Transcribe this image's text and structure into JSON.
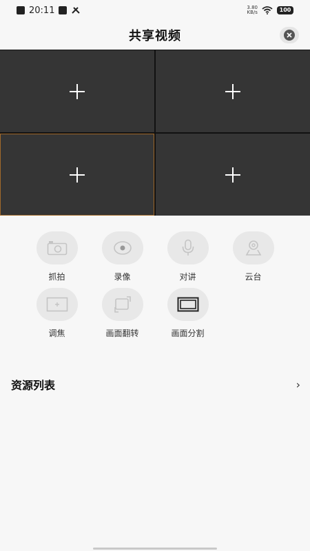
{
  "status_bar": {
    "time": "20:11",
    "net_speed_value": "3.80",
    "net_speed_unit": "KB/s",
    "battery": "100"
  },
  "header": {
    "title": "共享视频",
    "close_icon": "close-circle-icon"
  },
  "video_grid": {
    "cells": [
      {
        "icon": "plus-icon",
        "selected": false
      },
      {
        "icon": "plus-icon",
        "selected": false
      },
      {
        "icon": "plus-icon",
        "selected": true
      },
      {
        "icon": "plus-icon",
        "selected": false
      }
    ]
  },
  "controls": {
    "row1": [
      {
        "label": "抓拍",
        "icon": "camera-icon"
      },
      {
        "label": "录像",
        "icon": "eye-icon"
      },
      {
        "label": "对讲",
        "icon": "microphone-icon"
      },
      {
        "label": "云台",
        "icon": "ptz-icon"
      }
    ],
    "row2": [
      {
        "label": "调焦",
        "icon": "focus-icon"
      },
      {
        "label": "画面翻转",
        "icon": "flip-icon"
      },
      {
        "label": "画面分割",
        "icon": "split-screen-icon"
      }
    ]
  },
  "resource_list": {
    "title": "资源列表",
    "chevron": "›"
  },
  "colors": {
    "grid_bg": "#353535",
    "selected_border": "#a26a2a",
    "page_bg": "#f7f7f7"
  }
}
